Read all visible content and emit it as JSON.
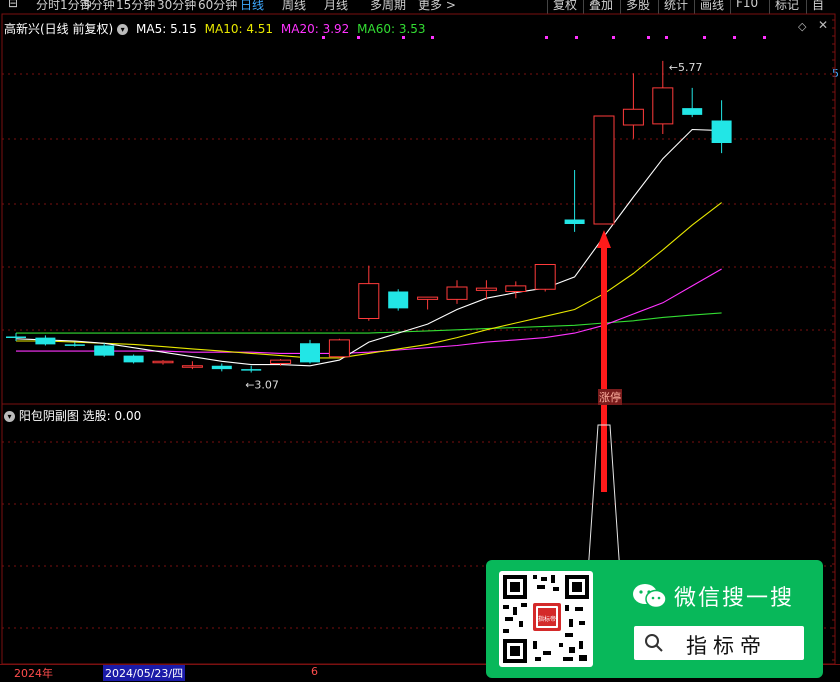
{
  "toolbar": {
    "left_items": [
      "分时",
      "1分钟",
      "5分钟",
      "15分钟",
      "30分钟",
      "60分钟",
      "日线",
      "周线",
      "月线",
      "多周期",
      "更多 >"
    ],
    "active_index": 6,
    "right_items": [
      "复权",
      "叠加",
      "多股",
      "统计",
      "画线",
      "F10",
      "标记",
      "自"
    ]
  },
  "header": {
    "stock_name": "高新兴(日线 前复权)",
    "ma5": "MA5: 5.15",
    "ma10": "MA10: 4.51",
    "ma20": "MA20: 3.92",
    "ma60": "MA60: 3.53",
    "right_axis_label": "5"
  },
  "sub_panel": {
    "title": "阳包阴副图",
    "value_label": "选股: 0.00"
  },
  "annotations": {
    "high": "5.77",
    "low": "3.07",
    "tag": "涨停"
  },
  "bottom": {
    "year": "2024年",
    "cursor_date": "2024/05/23/四",
    "month": "6"
  },
  "wechat": {
    "title": "微信搜一搜",
    "search_text": "指标帝",
    "qr_caption": "指标帝"
  },
  "colors": {
    "up": "#ff3b3b",
    "down": "#22e6e6",
    "ma5": "#ffffff",
    "ma10": "#e8e800",
    "ma20": "#ff33ff",
    "ma60": "#33dd33",
    "grid": "#7a1010",
    "arrow": "#ff1a1a",
    "wechat_green": "#08b85a"
  },
  "chart_data": {
    "type": "candlestick",
    "candles": [
      {
        "o": 3.32,
        "h": 3.35,
        "l": 3.28,
        "c": 3.31
      },
      {
        "o": 3.31,
        "h": 3.33,
        "l": 3.24,
        "c": 3.25
      },
      {
        "o": 3.25,
        "h": 3.27,
        "l": 3.23,
        "c": 3.24
      },
      {
        "o": 3.24,
        "h": 3.26,
        "l": 3.14,
        "c": 3.15
      },
      {
        "o": 3.15,
        "h": 3.16,
        "l": 3.08,
        "c": 3.09
      },
      {
        "o": 3.09,
        "h": 3.11,
        "l": 3.07,
        "c": 3.1
      },
      {
        "o": 3.05,
        "h": 3.1,
        "l": 3.03,
        "c": 3.06
      },
      {
        "o": 3.06,
        "h": 3.08,
        "l": 3.01,
        "c": 3.03
      },
      {
        "o": 3.03,
        "h": 3.06,
        "l": 3.0,
        "c": 3.02
      },
      {
        "o": 3.08,
        "h": 3.12,
        "l": 3.06,
        "c": 3.11
      },
      {
        "o": 3.26,
        "h": 3.29,
        "l": 3.08,
        "c": 3.09
      },
      {
        "o": 3.14,
        "h": 3.3,
        "l": 3.13,
        "c": 3.29
      },
      {
        "o": 3.48,
        "h": 3.95,
        "l": 3.46,
        "c": 3.79
      },
      {
        "o": 3.72,
        "h": 3.74,
        "l": 3.55,
        "c": 3.57
      },
      {
        "o": 3.65,
        "h": 3.67,
        "l": 3.56,
        "c": 3.67
      },
      {
        "o": 3.65,
        "h": 3.82,
        "l": 3.61,
        "c": 3.76
      },
      {
        "o": 3.73,
        "h": 3.82,
        "l": 3.65,
        "c": 3.75
      },
      {
        "o": 3.72,
        "h": 3.81,
        "l": 3.66,
        "c": 3.77
      },
      {
        "o": 3.74,
        "h": 3.96,
        "l": 3.72,
        "c": 3.96
      },
      {
        "o": 4.36,
        "h": 4.8,
        "l": 4.25,
        "c": 4.32
      },
      {
        "o": 4.32,
        "h": 5.28,
        "l": 4.32,
        "c": 5.28
      },
      {
        "o": 5.2,
        "h": 5.66,
        "l": 5.08,
        "c": 5.34
      },
      {
        "o": 5.21,
        "h": 5.77,
        "l": 5.12,
        "c": 5.53
      },
      {
        "o": 5.35,
        "h": 5.53,
        "l": 5.27,
        "c": 5.29
      },
      {
        "o": 5.24,
        "h": 5.42,
        "l": 4.95,
        "c": 5.04
      }
    ],
    "ma5": [
      3.3,
      3.29,
      3.28,
      3.26,
      3.22,
      3.18,
      3.14,
      3.1,
      3.07,
      3.07,
      3.06,
      3.11,
      3.27,
      3.35,
      3.43,
      3.56,
      3.66,
      3.71,
      3.75,
      3.85,
      4.21,
      4.56,
      4.9,
      5.16,
      5.15
    ],
    "ma10": [
      3.28,
      3.28,
      3.27,
      3.26,
      3.25,
      3.23,
      3.21,
      3.19,
      3.17,
      3.15,
      3.13,
      3.13,
      3.17,
      3.21,
      3.25,
      3.31,
      3.38,
      3.44,
      3.5,
      3.56,
      3.7,
      3.88,
      4.09,
      4.31,
      4.51
    ],
    "ma20": [
      3.19,
      3.19,
      3.19,
      3.19,
      3.19,
      3.19,
      3.18,
      3.18,
      3.18,
      3.17,
      3.17,
      3.17,
      3.18,
      3.2,
      3.22,
      3.24,
      3.27,
      3.29,
      3.31,
      3.35,
      3.42,
      3.52,
      3.62,
      3.77,
      3.92
    ],
    "ma60": [
      3.35,
      3.35,
      3.35,
      3.35,
      3.35,
      3.35,
      3.35,
      3.35,
      3.35,
      3.35,
      3.35,
      3.35,
      3.35,
      3.36,
      3.37,
      3.38,
      3.39,
      3.4,
      3.41,
      3.42,
      3.44,
      3.46,
      3.49,
      3.51,
      3.53
    ],
    "ylim": [
      2.8,
      6.0
    ],
    "signal_index": 20,
    "ma_start_index": 0
  }
}
